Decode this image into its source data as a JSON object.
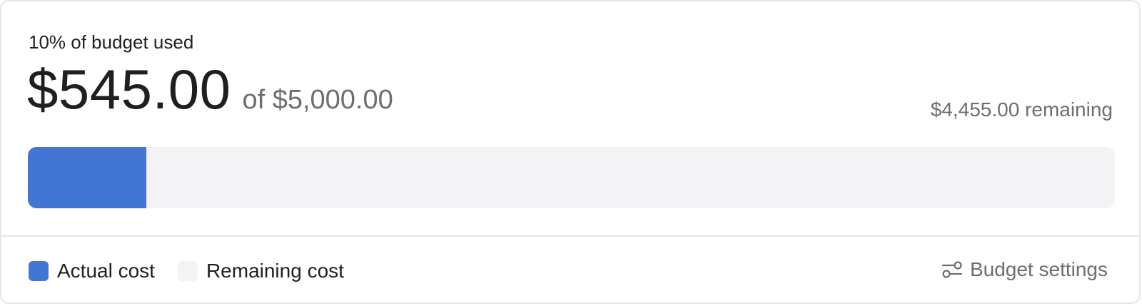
{
  "budget": {
    "usage_label": "10% of budget used",
    "spent": "$545.00",
    "total": "of $5,000.00",
    "remaining_text": "$4,455.00 remaining",
    "progress_fraction": 0.109
  },
  "legend": {
    "actual_label": "Actual cost",
    "remaining_label": "Remaining cost"
  },
  "settings": {
    "label": "Budget settings",
    "icon": "sliders-icon"
  },
  "colors": {
    "actual": "#4375d4",
    "remaining": "#f3f2f4",
    "text_primary": "#1f1f1f",
    "text_secondary": "#6e6e6e"
  }
}
